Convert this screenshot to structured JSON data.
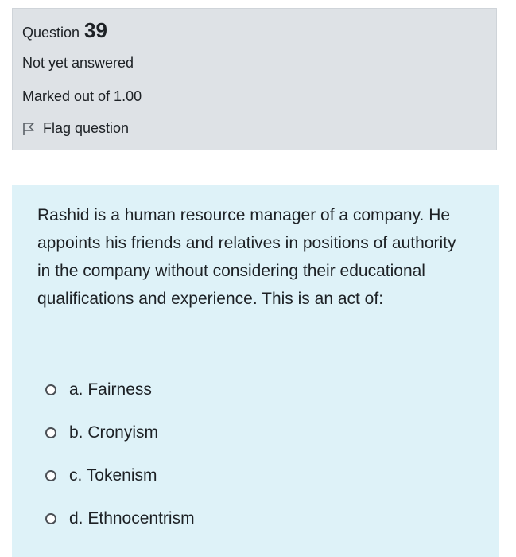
{
  "info": {
    "question_label": "Question",
    "question_number": "39",
    "state": "Not yet answered",
    "grade": "Marked out of 1.00",
    "flag_label": "Flag question"
  },
  "question": {
    "text": "Rashid is a human resource manager of a company. He appoints his friends and relatives in positions of authority in the company without considering their educational qualifications and experience. This is an act of:"
  },
  "answers": [
    {
      "label": "a. Fairness",
      "selected": false
    },
    {
      "label": "b. Cronyism",
      "selected": false
    },
    {
      "label": "c. Tokenism",
      "selected": false
    },
    {
      "label": "d. Ethnocentrism",
      "selected": false
    }
  ],
  "colors": {
    "info_background": "#dee2e6",
    "content_background": "#def2f8",
    "text": "#1d2125"
  },
  "icons": {
    "flag": "flag-outline-icon",
    "radio": "radio-unchecked-icon"
  }
}
